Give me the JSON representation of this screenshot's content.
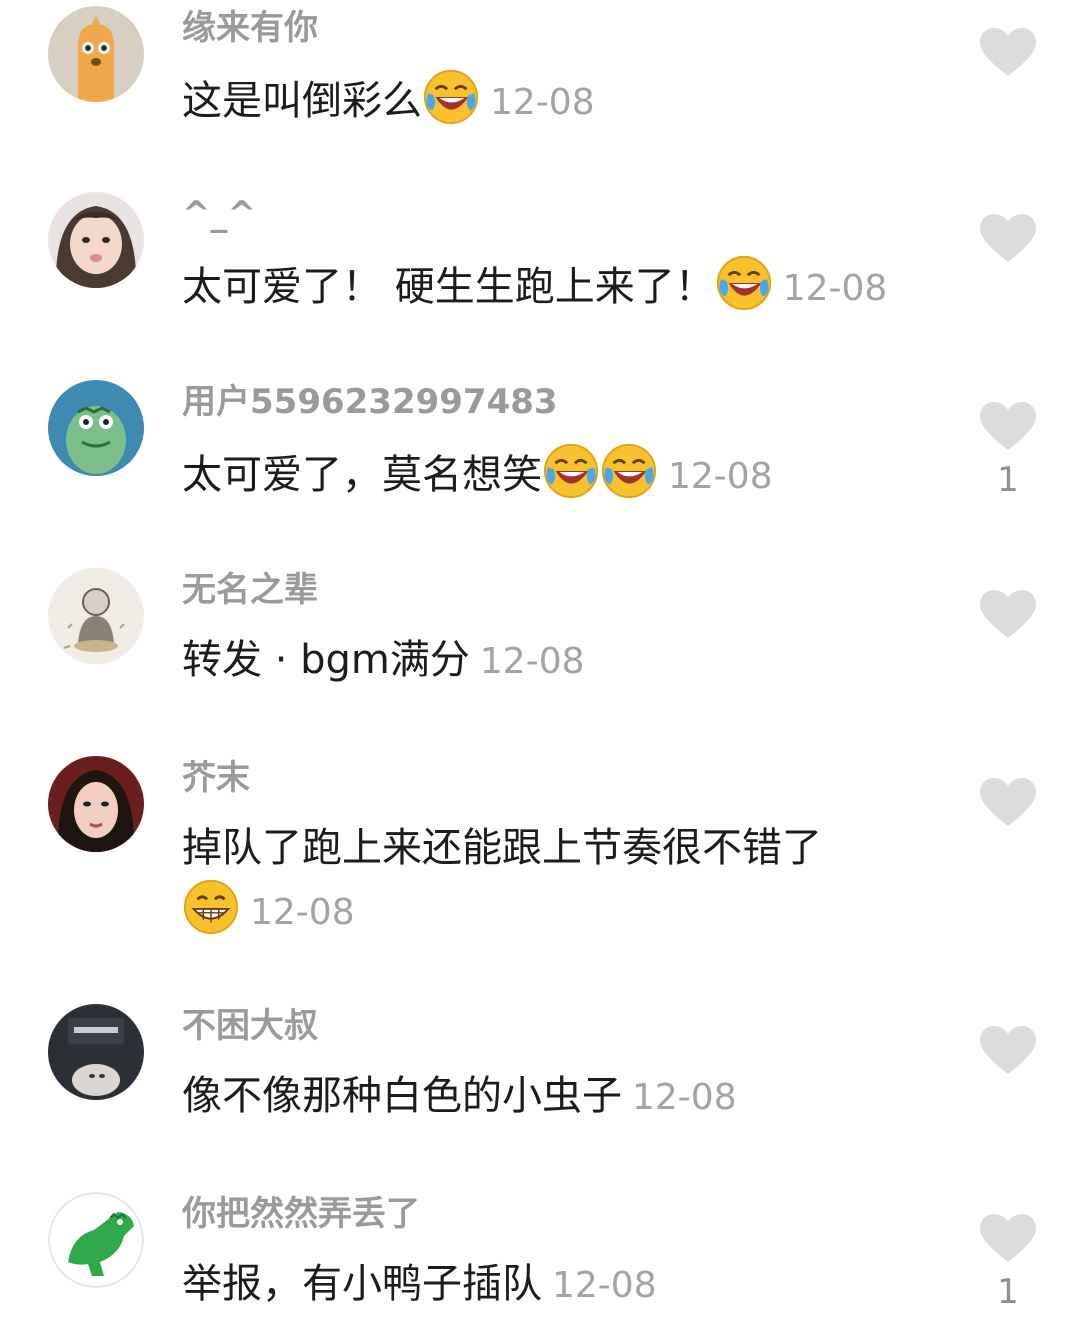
{
  "comments": [
    {
      "username": "缘来有你",
      "text": "这是叫倒彩么",
      "emojis": [
        "rofl-crying-emoji"
      ],
      "time": "12-08",
      "likes": ""
    },
    {
      "username": "^_^",
      "text": "太可爱了！ 硬生生跑上来了！",
      "emojis": [
        "rofl-crying-emoji"
      ],
      "time": "12-08",
      "likes": ""
    },
    {
      "username": "用户5596232997483",
      "text": "太可爱了，莫名想笑",
      "emojis": [
        "rofl-crying-emoji",
        "rofl-crying-emoji"
      ],
      "time": "12-08",
      "likes": "1"
    },
    {
      "username": "无名之辈",
      "text": "转发 · bgm满分",
      "emojis": [],
      "time": "12-08",
      "likes": ""
    },
    {
      "username": "芥末",
      "text": "掉队了跑上来还能跟上节奏很不错了",
      "emojis": [
        "grin-emoji"
      ],
      "time": "12-08",
      "likes": ""
    },
    {
      "username": "不困大叔",
      "text": "像不像那种白色的小虫子",
      "emojis": [],
      "time": "12-08",
      "likes": ""
    },
    {
      "username": "你把然然弄丢了",
      "text": "举报，有小鸭子插队",
      "emojis": [],
      "time": "12-08",
      "likes": "1"
    }
  ],
  "colors": {
    "username": "#9a9a9a",
    "text": "#1c1c1c",
    "time": "#a3a3a3",
    "heart": "#dcdcdc"
  }
}
